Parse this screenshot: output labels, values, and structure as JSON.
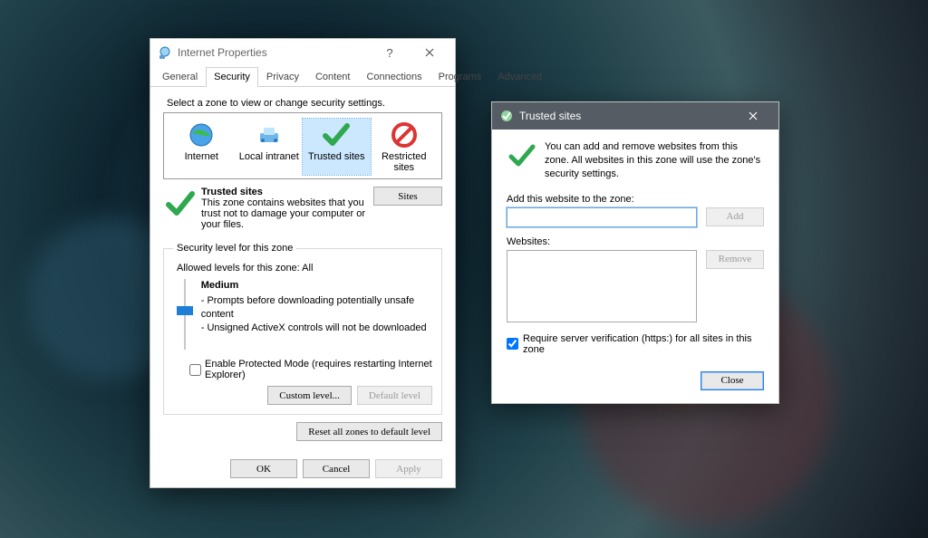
{
  "dialog1": {
    "title": "Internet Properties",
    "tabs": [
      "General",
      "Security",
      "Privacy",
      "Content",
      "Connections",
      "Programs",
      "Advanced"
    ],
    "active_tab": "Security",
    "zone_instruction": "Select a zone to view or change security settings.",
    "zones": [
      "Internet",
      "Local intranet",
      "Trusted sites",
      "Restricted sites"
    ],
    "selected_zone": "Trusted sites",
    "zone_detail": {
      "title": "Trusted sites",
      "body": "This zone contains websites that you trust not to damage your computer or your files.",
      "sites_btn": "Sites"
    },
    "level_legend": "Security level for this zone",
    "allowed": "Allowed levels for this zone: All",
    "level_name": "Medium",
    "level_line1": "- Prompts before downloading potentially unsafe content",
    "level_line2": "- Unsigned ActiveX controls will not be downloaded",
    "protected_mode": "Enable Protected Mode (requires restarting Internet Explorer)",
    "custom_btn": "Custom level...",
    "default_btn": "Default level",
    "reset_btn": "Reset all zones to default level",
    "ok": "OK",
    "cancel": "Cancel",
    "apply": "Apply"
  },
  "dialog2": {
    "title": "Trusted sites",
    "intro": "You can add and remove websites from this zone. All websites in this zone will use the zone's security settings.",
    "add_label": "Add this website to the zone:",
    "add_btn": "Add",
    "websites_label": "Websites:",
    "remove_btn": "Remove",
    "require_https": "Require server verification (https:) for all sites in this zone",
    "close": "Close"
  }
}
